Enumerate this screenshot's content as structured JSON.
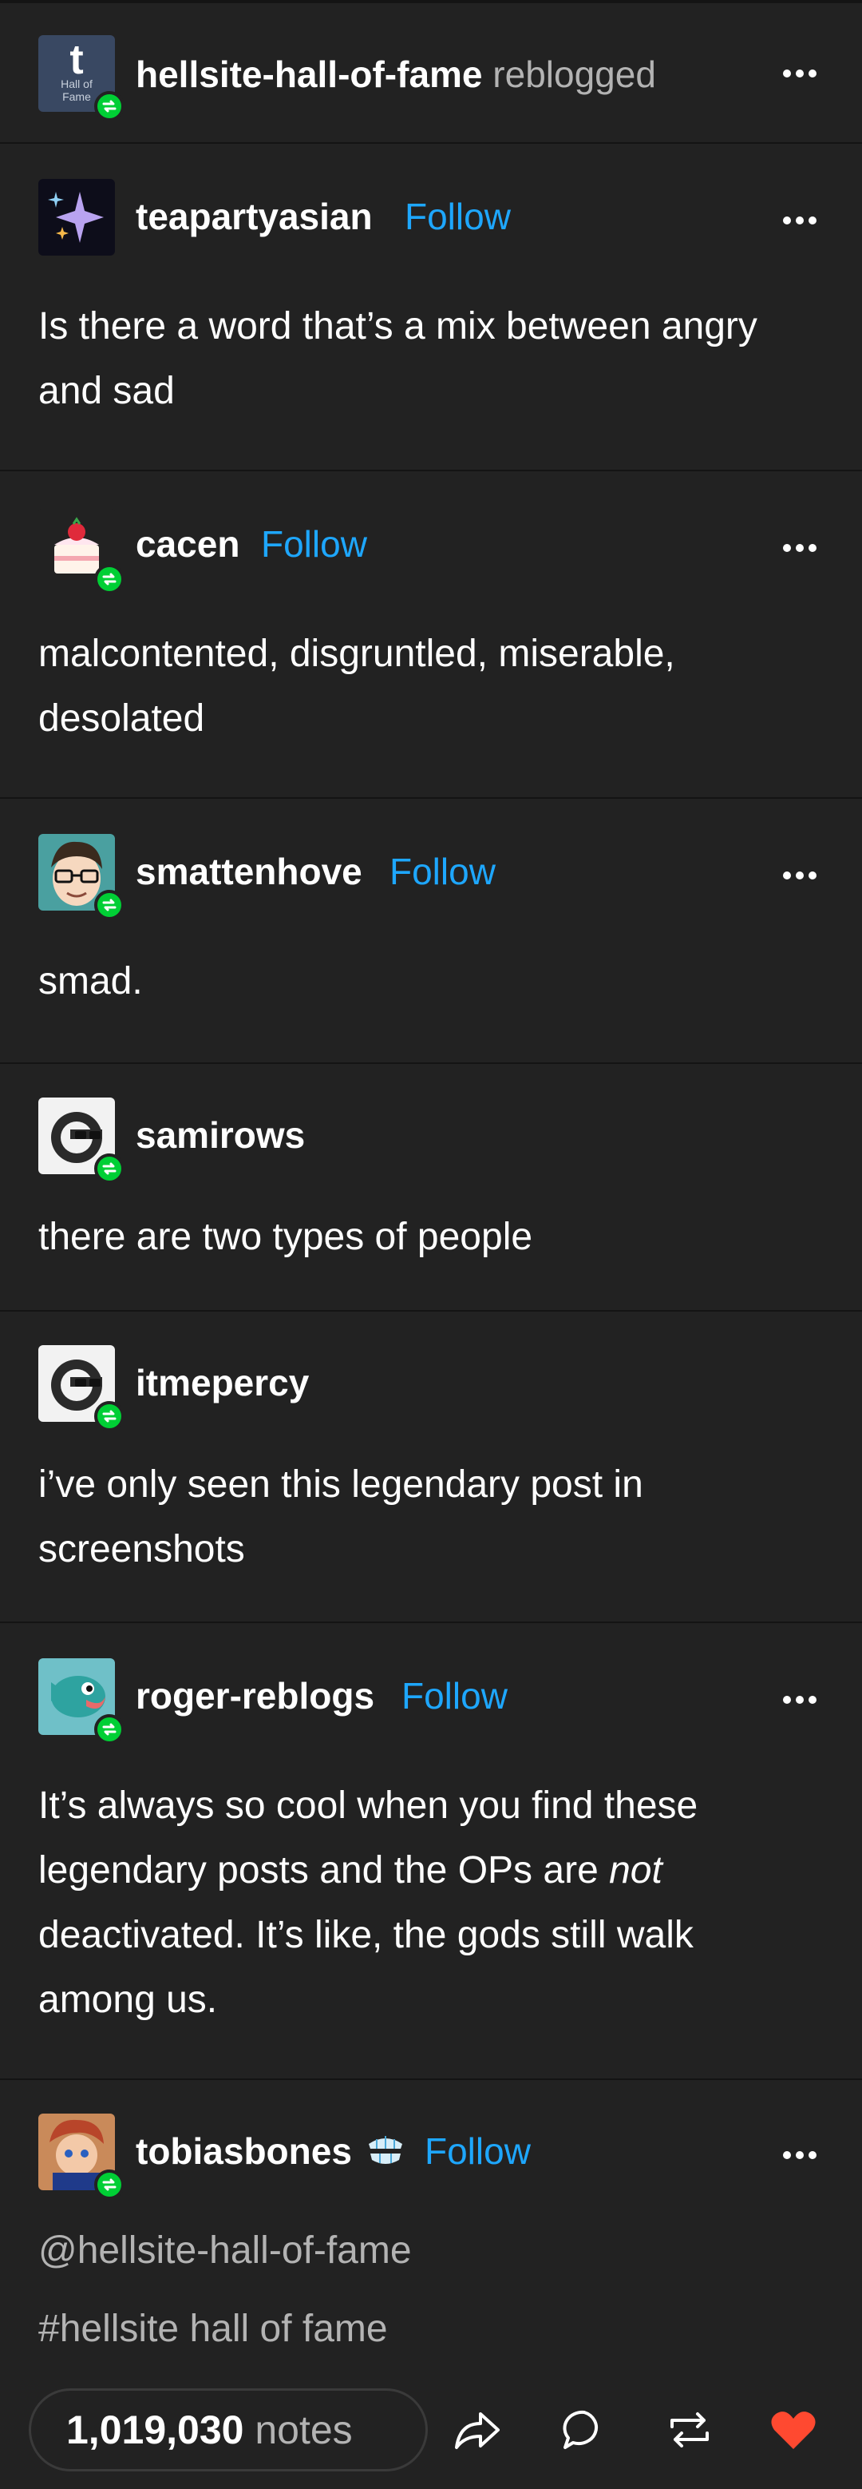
{
  "header": {
    "username": "hellsite-hall-of-fame",
    "action": "reblogged",
    "avatar_text": "t",
    "avatar_subtext_1": "Hall of",
    "avatar_subtext_2": "Fame"
  },
  "posts": [
    {
      "username": "teapartyasian",
      "follow": "Follow",
      "text": "Is there a word that’s a mix between angry and sad",
      "avatar_icon": "sparkle-icon"
    },
    {
      "username": "cacen",
      "follow": "Follow",
      "text": "malcontented, disgruntled, miserable, desolated",
      "avatar_icon": "cake-icon"
    },
    {
      "username": "smattenhove",
      "follow": "Follow",
      "text": "smad.",
      "avatar_icon": "glasses-man-icon"
    },
    {
      "username": "samirows",
      "text": "there are two types of people",
      "avatar_icon": "sunglasses-face-icon"
    },
    {
      "username": "itmepercy",
      "text": "i’ve only seen this legendary post in screenshots",
      "avatar_icon": "sunglasses-face-icon"
    },
    {
      "username": "roger-reblogs",
      "follow": "Follow",
      "text_1": "It’s always so cool when you find these legendary posts and the OPs are ",
      "text_em": "not",
      "text_2": " deactivated. It’s like, the gods still walk among us.",
      "avatar_icon": "fish-icon"
    },
    {
      "username": "tobiasbones",
      "follow": "Follow",
      "mention": "@hellsite-hall-of-fame",
      "tag": "#hellsite hall of fame",
      "avatar_icon": "cartoon-boy-icon",
      "badge_icon": "teeth-icon"
    }
  ],
  "footer": {
    "notes_count": "1,019,030",
    "notes_label": "notes",
    "like_color": "#ff4930"
  },
  "colors": {
    "background": "#222222",
    "follow": "#1ea7ff",
    "reblog_badge": "#00cf35"
  }
}
